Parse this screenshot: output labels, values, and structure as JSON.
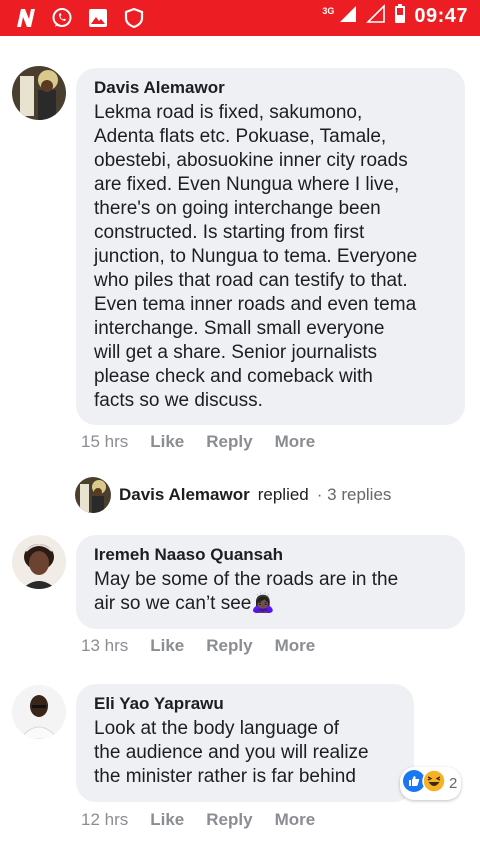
{
  "status_bar": {
    "network": "3G",
    "time": "09:47",
    "colors": {
      "background": "#ec1d23"
    },
    "icons": [
      "n-app-icon",
      "whatsapp-icon",
      "gallery-icon",
      "shield-icon",
      "signal-icon",
      "signal-empty-icon",
      "battery-icon"
    ]
  },
  "comments": [
    {
      "author": "Davis Alemawor",
      "text": "Lekma road is fixed, sakumono,\nAdenta flats etc. Pokuase, Tamale,\nobestebi, abosuokine inner city roads\nare fixed. Even Nungua where I live,\nthere's on going interchange been\nconstructed. Is starting from first\njunction, to Nungua to tema. Everyone\nwho piles that road can testify to that.\nEven tema inner roads and even tema\ninterchange. Small small everyone\nwill get a share. Senior journalists\nplease check and comeback with\nfacts so we discuss.",
      "time": "15 hrs",
      "like": "Like",
      "reply": "Reply",
      "more": "More"
    },
    {
      "author": "Iremeh Naaso Quansah",
      "text": "May be some of the roads are in the\nair so we can’t see🙇🏿‍♀️",
      "time": "13 hrs",
      "like": "Like",
      "reply": "Reply",
      "more": "More"
    },
    {
      "author": "Eli Yao Yaprawu",
      "text": "Look at the body language of\nthe audience and you will realize\nthe minister rather is far behind",
      "time": "12 hrs",
      "like": "Like",
      "reply": "Reply",
      "more": "More"
    }
  ],
  "replies_row": {
    "name": "Davis Alemawor",
    "replied": "replied",
    "count": "· 3 replies"
  },
  "reactions": {
    "count": "2",
    "types": [
      "like-reaction-icon",
      "haha-reaction-icon"
    ]
  }
}
